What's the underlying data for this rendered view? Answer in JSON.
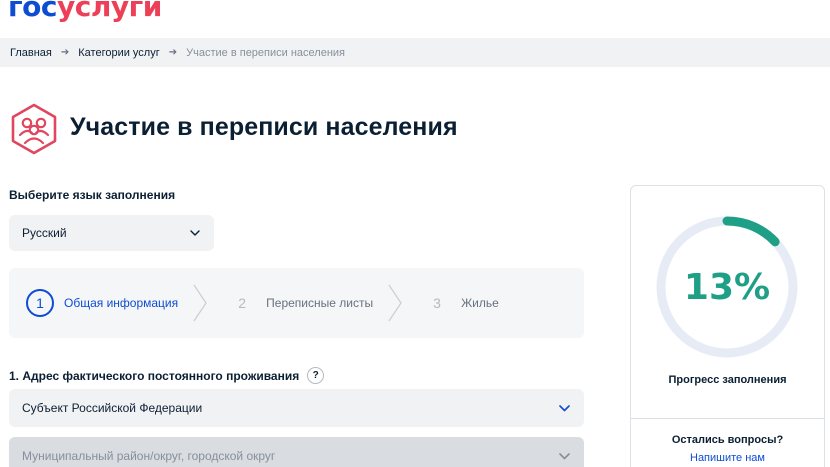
{
  "logo": {
    "part1": "гос",
    "part2": "услуги"
  },
  "breadcrumbs": [
    {
      "label": "Главная"
    },
    {
      "label": "Категории услуг"
    },
    {
      "label": "Участие в переписи населения"
    }
  ],
  "page": {
    "title": "Участие в переписи населения",
    "icon": "census-people-icon"
  },
  "language": {
    "label": "Выберите язык заполнения",
    "selected": "Русский"
  },
  "steps": [
    {
      "num": "1",
      "label": "Общая информация",
      "active": true
    },
    {
      "num": "2",
      "label": "Переписные листы",
      "active": false
    },
    {
      "num": "3",
      "label": "Жилье",
      "active": false
    }
  ],
  "address": {
    "label": "1. Адрес фактического постоянного проживания",
    "help": "?",
    "field1": "Субъект Российской Федерации",
    "field2": "Муниципальный район/округ, городской округ"
  },
  "progress": {
    "percent": 13,
    "text": "13%",
    "caption": "Прогресс заполнения"
  },
  "help_box": {
    "title": "Остались вопросы?",
    "link": "Напишите нам"
  },
  "colors": {
    "brand_blue": "#0d4cd3",
    "brand_red": "#ee3f58",
    "progress": "#1e9f86",
    "service_icon": "#e0475f"
  }
}
